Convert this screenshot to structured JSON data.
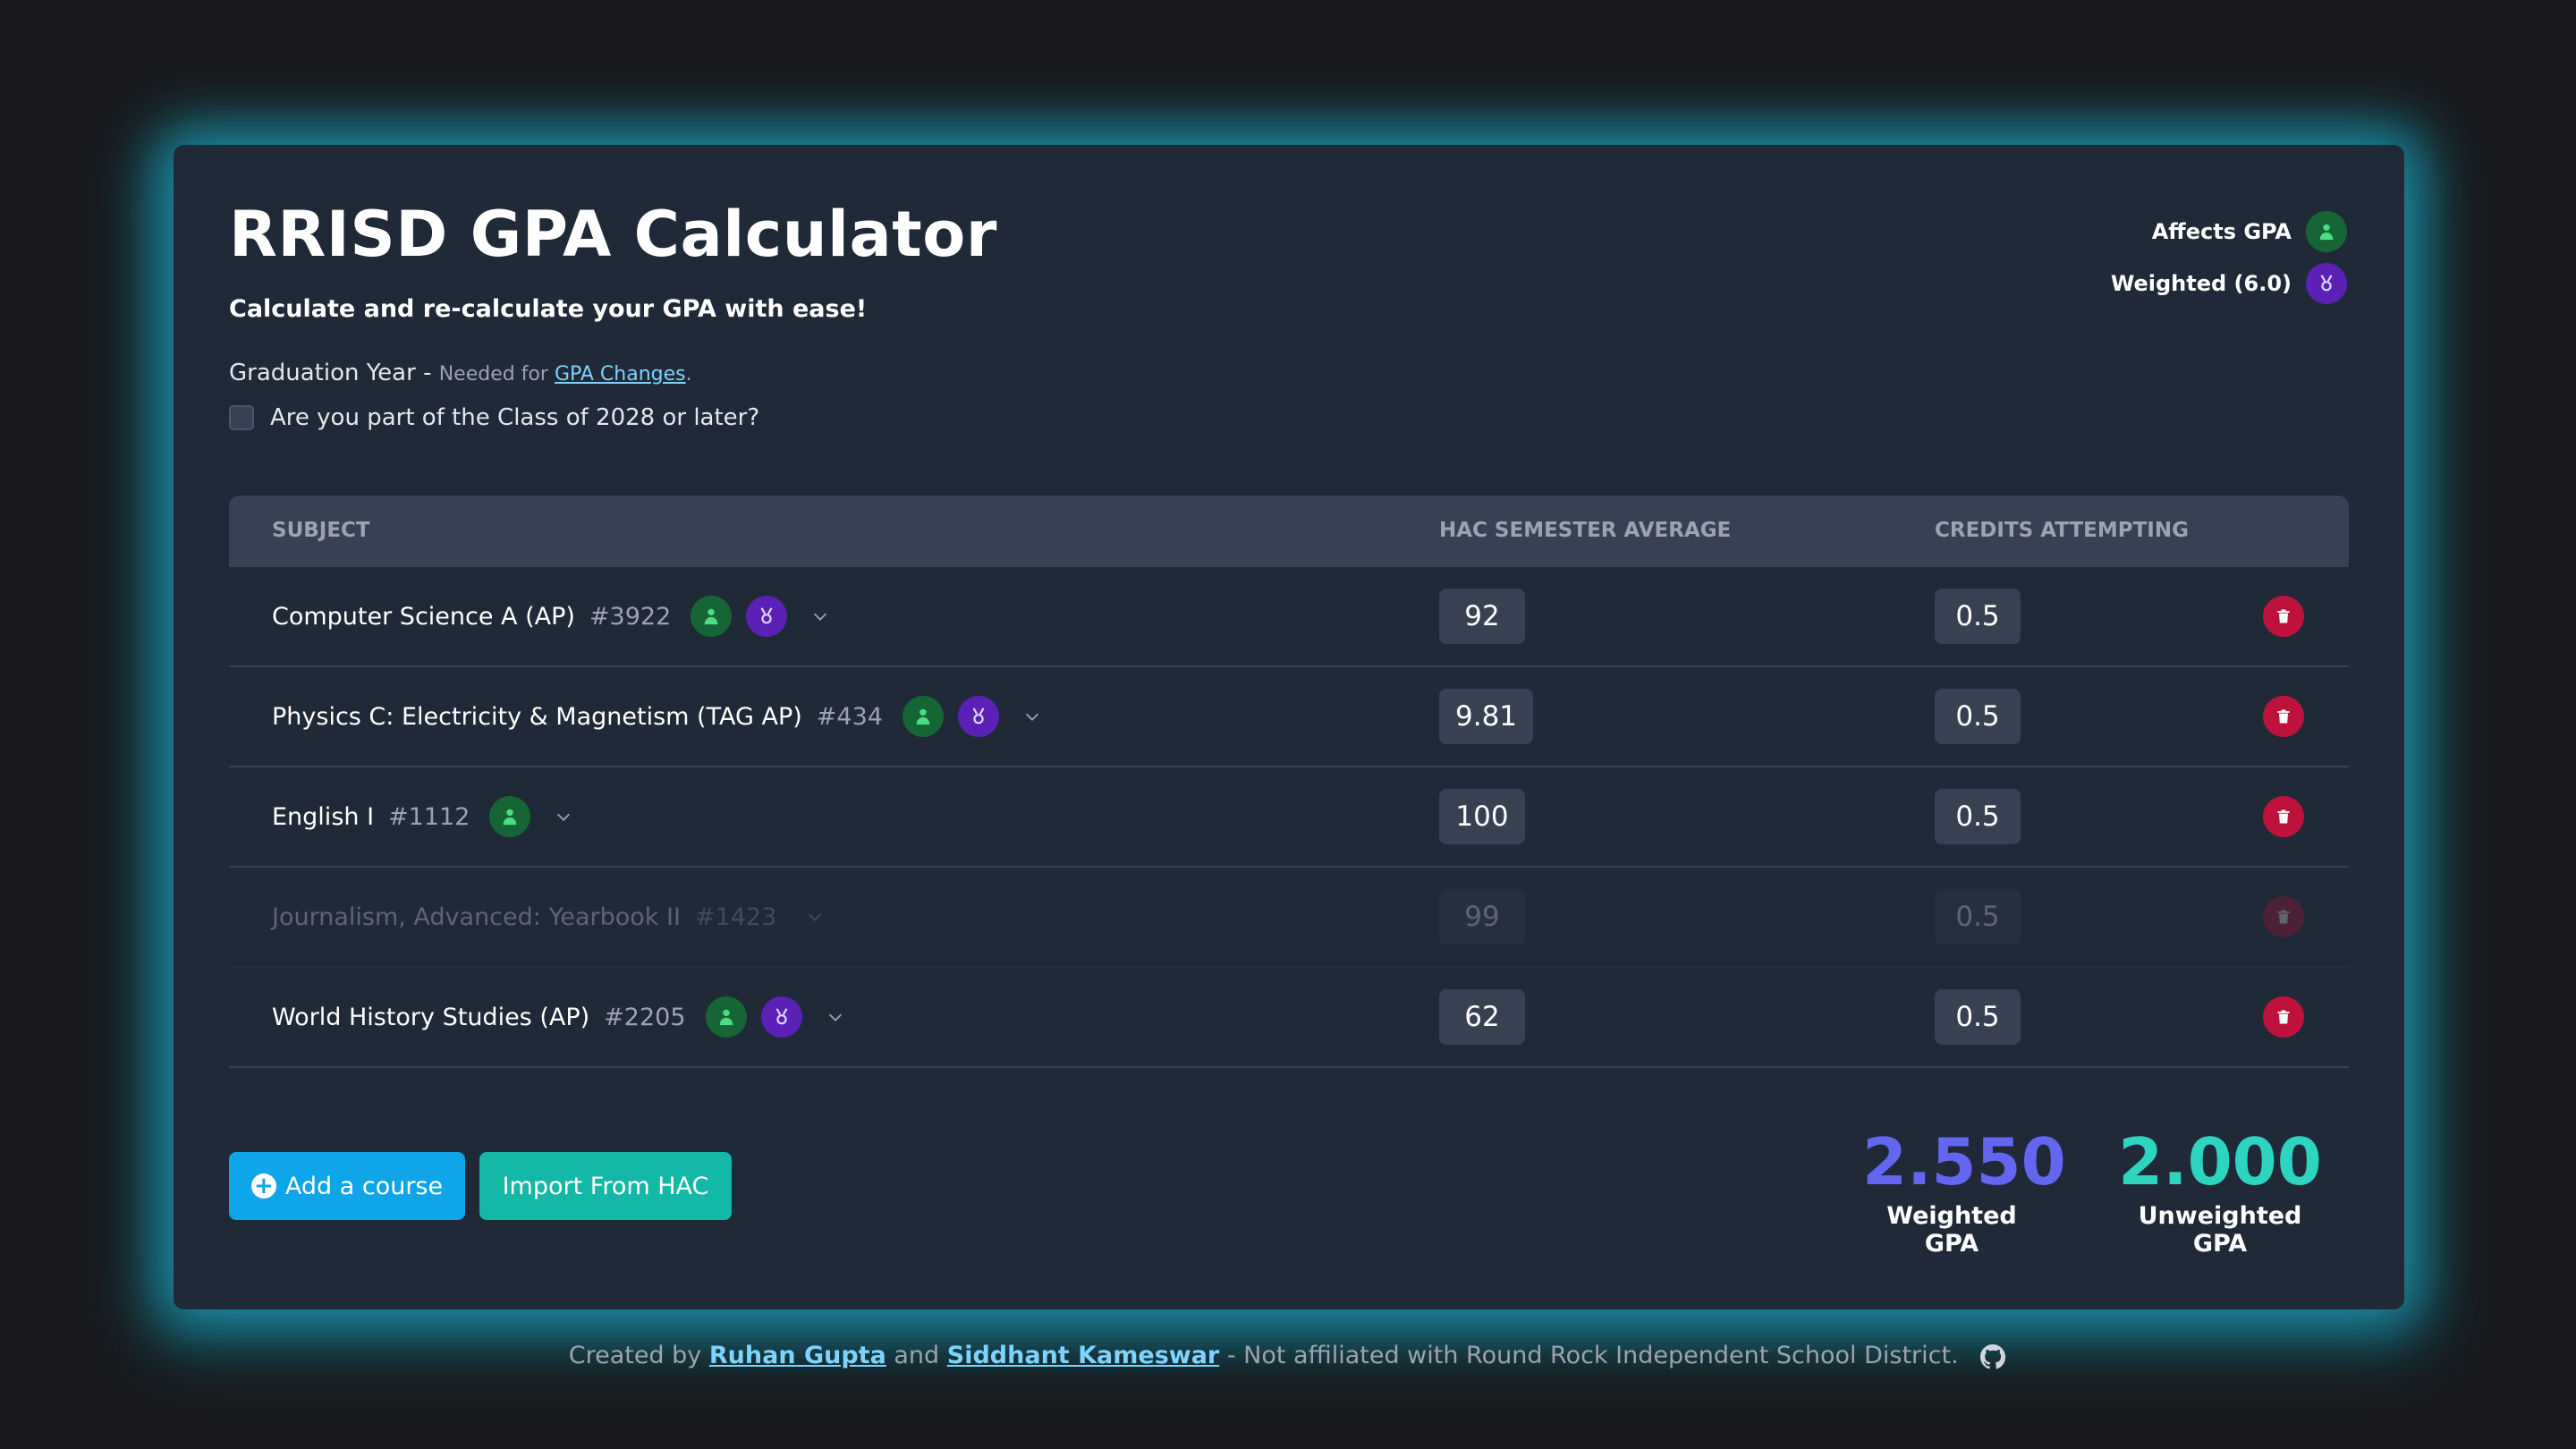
{
  "header": {
    "title": "RRISD GPA Calculator",
    "subtitle": "Calculate and re-calculate your GPA with ease!",
    "graduation_label": "Graduation Year -",
    "graduation_note_prefix": "Needed for",
    "graduation_note_link": "GPA Changes",
    "graduation_note_suffix": ".",
    "class_checkbox_label": "Are you part of the Class of 2028 or later?",
    "class_checkbox_checked": false
  },
  "legend": {
    "affects_gpa": "Affects GPA",
    "weighted": "Weighted (6.0)",
    "affects_gpa_icon": "graduate-icon",
    "weighted_icon": "medal-icon",
    "affects_gpa_color": "#166534",
    "weighted_color": "#5b21b6"
  },
  "table": {
    "columns": [
      "SUBJECT",
      "HAC SEMESTER AVERAGE",
      "CREDITS ATTEMPTING"
    ],
    "rows": [
      {
        "subject": "Computer Science A (AP)",
        "code": "#3922",
        "average": "92",
        "credits": "0.5"
      },
      {
        "subject": "Physics C: Electricity & Magnetism (TAG AP)",
        "code": "#434",
        "average": "9.81",
        "credits": "0.5"
      },
      {
        "subject": "English I",
        "code": "#1112",
        "average": "100",
        "credits": "0.5"
      },
      {
        "subject": "Journalism, Advanced: Yearbook II",
        "code": "#1423",
        "average": "99",
        "credits": "0.5"
      },
      {
        "subject": "World History Studies (AP)",
        "code": "#2205",
        "average": "62",
        "credits": "0.5"
      }
    ]
  },
  "actions": {
    "add_course": "Add a course",
    "import_hac": "Import From HAC"
  },
  "results": {
    "weighted_value": "2.550",
    "weighted_label": "Weighted GPA",
    "unweighted_value": "2.000",
    "unweighted_label": "Unweighted GPA"
  },
  "footer": {
    "created_by": "Created by",
    "author1": "Ruhan Gupta",
    "and": "and",
    "author2": "Siddhant Kameswar",
    "disclaimer": "- Not affiliated with Round Rock Independent School District."
  },
  "colors": {
    "accent_blue": "#0ea5e9",
    "accent_teal": "#14b8a6",
    "weighted_gpa": "#6366f1",
    "unweighted_gpa": "#2dd4bf",
    "delete": "#be123c"
  }
}
